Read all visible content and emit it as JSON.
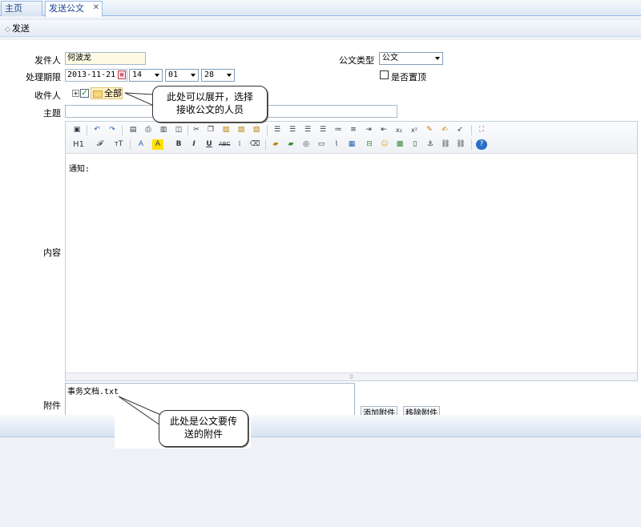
{
  "tabs": {
    "home": "主页",
    "send_doc": "发送公文",
    "close": "✕"
  },
  "toolbar": {
    "send_label": "发送"
  },
  "form": {
    "sender_label": "发件人",
    "sender_value": "何波龙",
    "deadline_label": "处理期限",
    "date_value": "2013-11-21",
    "hour_value": "14",
    "minute_value": "01",
    "second_value": "28",
    "doctype_label": "公文类型",
    "doctype_value": "公文",
    "pin_label": "是否置顶",
    "recipient_label": "收件人",
    "recipient_all": "全部",
    "subject_label": "主题",
    "subject_value": "",
    "content_label": "内容",
    "content_value": "通知:",
    "attachment_label": "附件",
    "attachment_file": "事务文档.txt",
    "add_attachment": "添加附件",
    "remove_attachment": "移除附件"
  },
  "editor_toolbar": {
    "heading": "H1",
    "font_family": "𝓕",
    "font_size": "тT",
    "bold": "B",
    "italic": "I",
    "underline": "U",
    "strikethrough": "ABC",
    "subscript": "x₂",
    "superscript": "x²"
  },
  "callouts": {
    "recipient_line1": "此处可以展开，选择",
    "recipient_line2": "接收公文的人员",
    "attachment_line1": "此处是公文要传",
    "attachment_line2": "送的附件"
  },
  "colors": {
    "tab_text": "#15428b",
    "border": "#99bbe8",
    "sender_bg": "#fdfbe3",
    "folder": "#f5d77a"
  }
}
